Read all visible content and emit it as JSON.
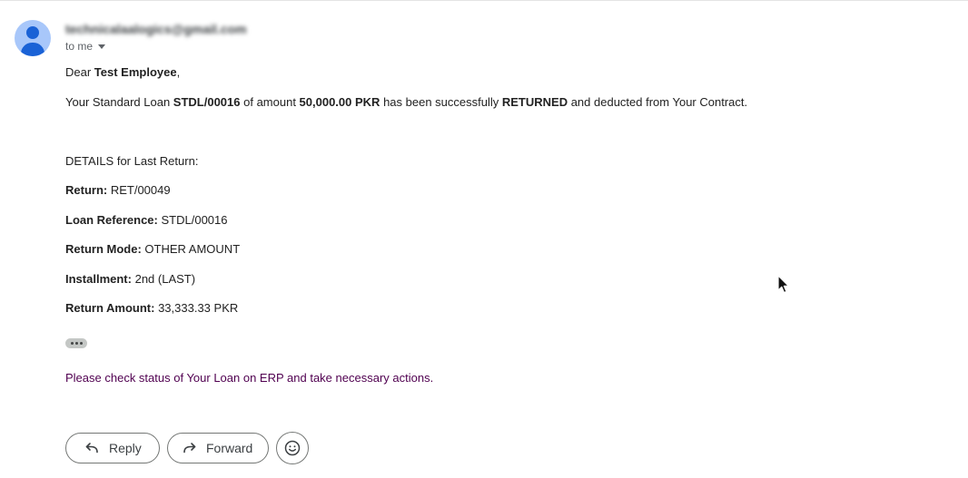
{
  "email": {
    "sender": "technicalaalogics@gmail.com",
    "to_label": "to me",
    "greeting_prefix": "Dear ",
    "employee_name": "Test Employee",
    "greeting_suffix": ",",
    "message": {
      "part1": "Your Standard Loan ",
      "loan_ref": "STDL/00016",
      "part2": " of amount ",
      "amount": "50,000.00 PKR",
      "part3": " has been successfully ",
      "status": "RETURNED",
      "part4": " and deducted from Your Contract."
    },
    "details_heading": "DETAILS for Last Return:",
    "details": [
      {
        "label": "Return:",
        "value": "RET/00049"
      },
      {
        "label": "Loan Reference:",
        "value": "STDL/00016"
      },
      {
        "label": "Return Mode:",
        "value": "OTHER AMOUNT"
      },
      {
        "label": "Installment:",
        "value": "2nd (LAST)"
      },
      {
        "label": "Return Amount:",
        "value": "33,333.33 PKR"
      }
    ],
    "notice": "Please check status of Your Loan on ERP and take necessary actions."
  },
  "actions": {
    "reply_label": "Reply",
    "forward_label": "Forward"
  },
  "icons": {
    "avatar": "person-avatar-icon",
    "reply": "reply-arrow-icon",
    "forward": "forward-arrow-icon",
    "emoji": "smiley-emoji-icon",
    "show_trimmed": "ellipsis-icon"
  },
  "colors": {
    "avatar_bg": "#a8c7fa",
    "avatar_fg": "#1a62d6",
    "notice_text": "#500050"
  }
}
